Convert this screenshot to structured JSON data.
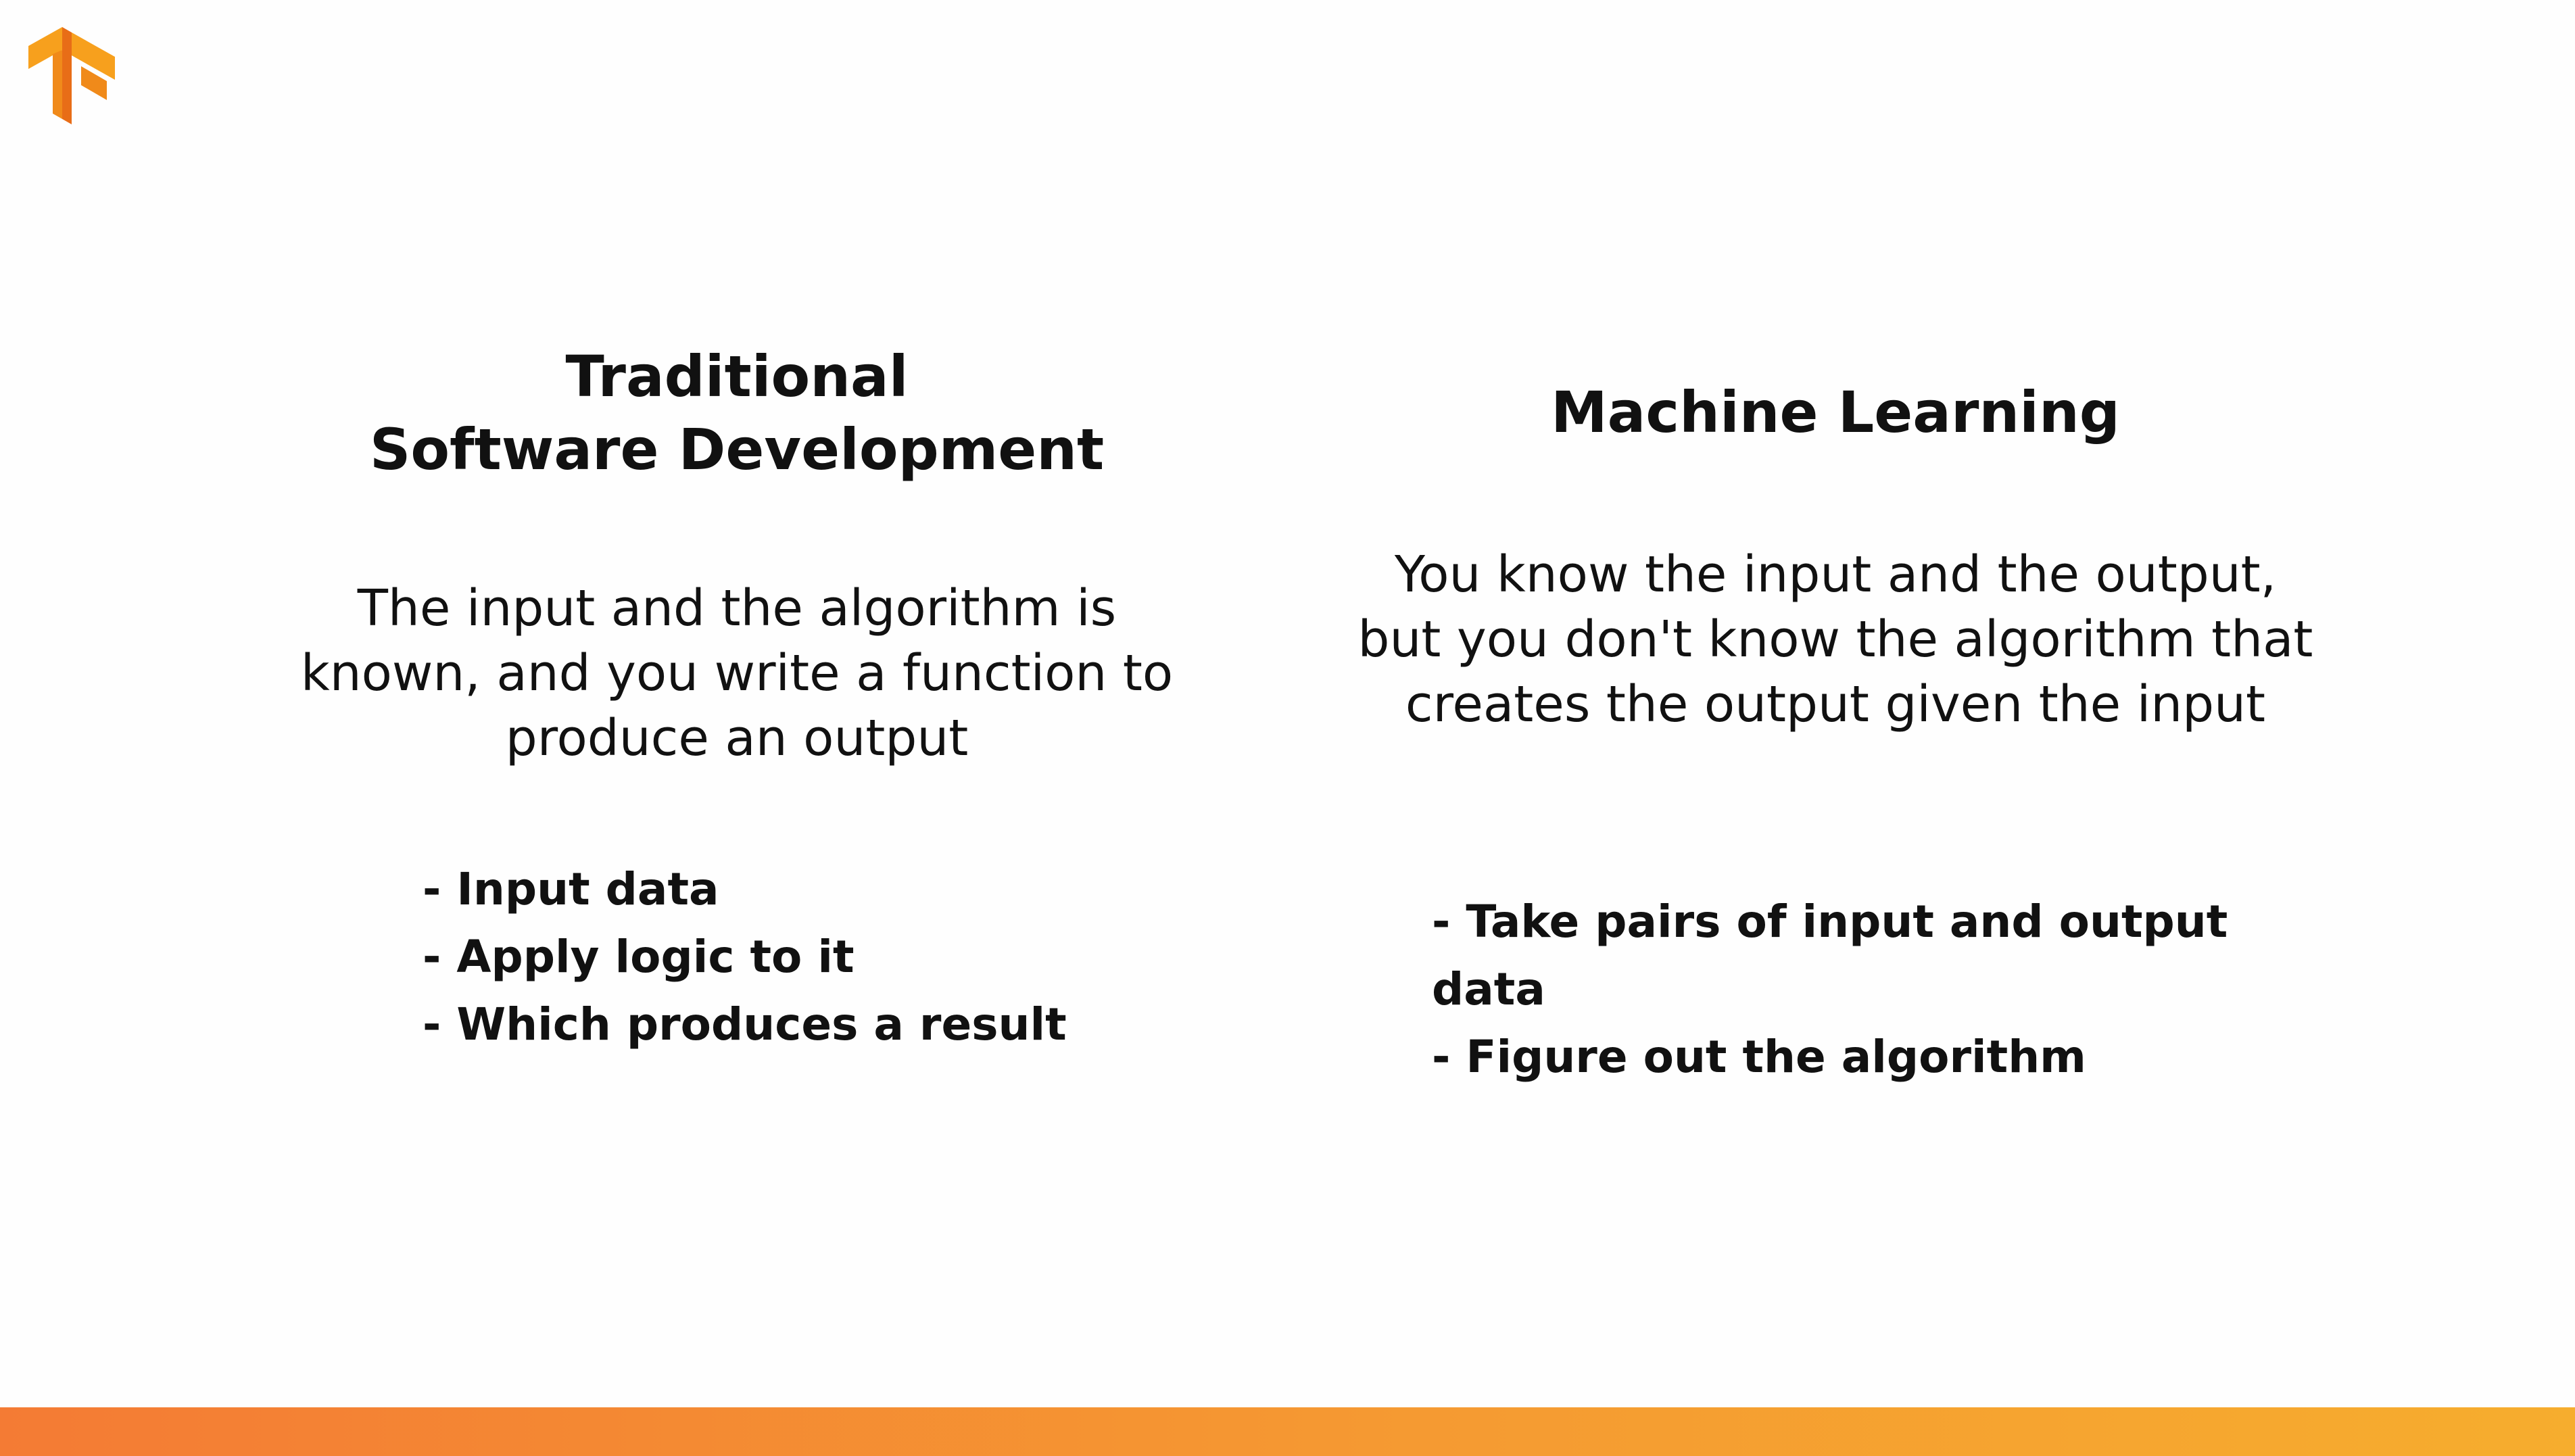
{
  "logo": {
    "icon": "tensorflow-logo-icon",
    "colors": [
      "#f7a01d",
      "#f08a1a",
      "#e86d17"
    ]
  },
  "columns": [
    {
      "heading_lines": [
        "Traditional",
        "Software Development"
      ],
      "description": "The input and the algorithm is known, and you write a function to produce an output",
      "bullets": [
        "- Input data",
        "- Apply logic to it",
        "- Which produces a result"
      ]
    },
    {
      "heading_lines": [
        "Machine Learning"
      ],
      "description": "You know the input and the output, but you don't know the algorithm that creates the output given the input",
      "bullets": [
        "- Take pairs of input and output data",
        "- Figure out the algorithm"
      ]
    }
  ],
  "footer": {
    "gradient_colors": [
      "#f47b34",
      "#f59a32",
      "#f6ad2e"
    ]
  }
}
